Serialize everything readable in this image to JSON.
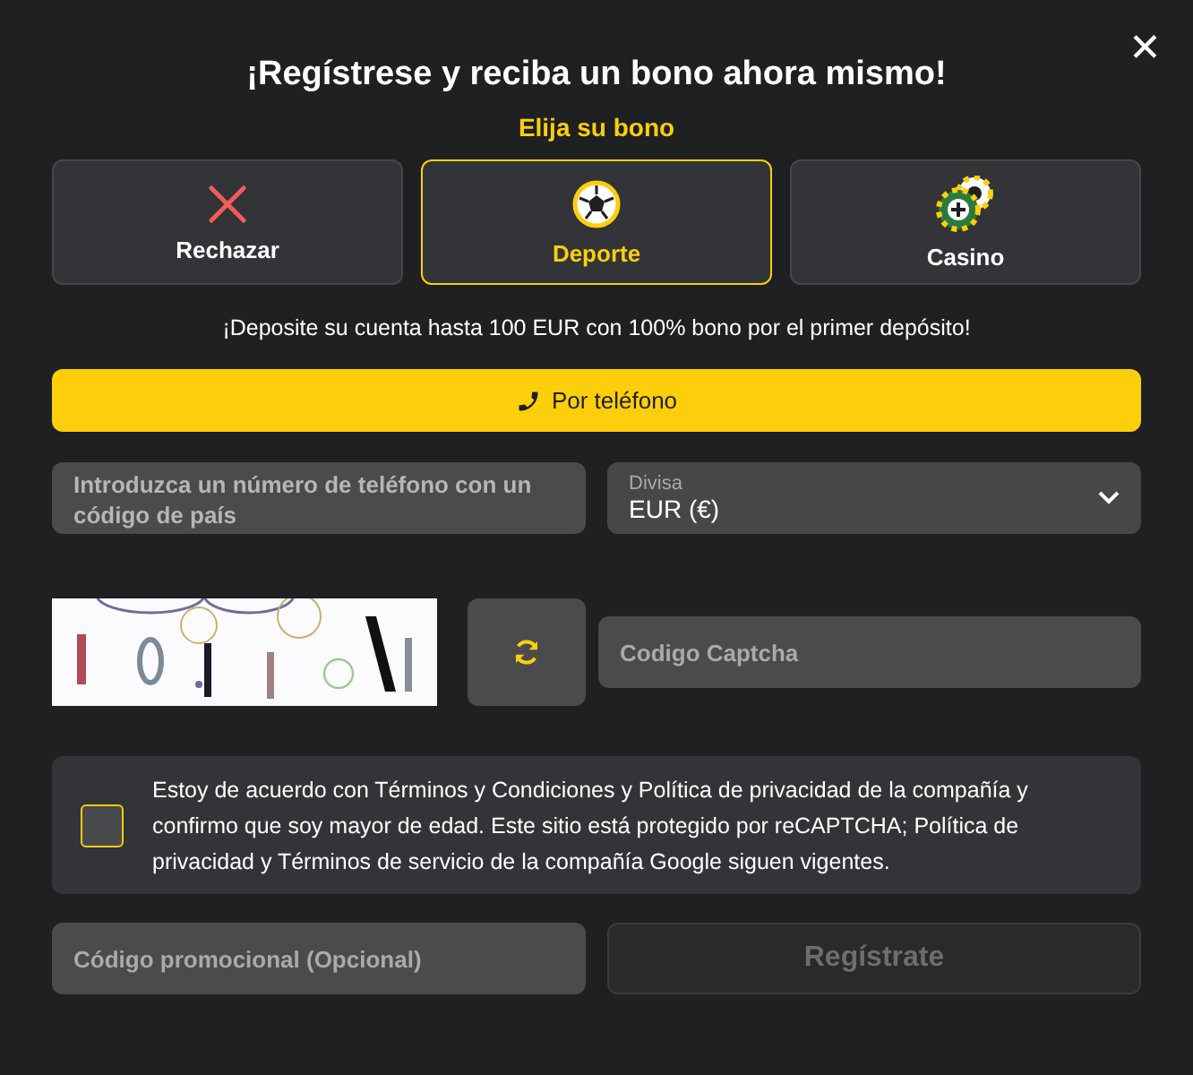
{
  "close_label": "✕",
  "title": "¡Regístrese y reciba un bono ahora mismo!",
  "subtitle": "Elija su bono",
  "bonuses": [
    {
      "label": "Rechazar",
      "kind": "reject",
      "selected": false
    },
    {
      "label": "Deporte",
      "kind": "sport",
      "selected": true
    },
    {
      "label": "Casino",
      "kind": "casino",
      "selected": false
    }
  ],
  "promo_text": "¡Deposite su cuenta hasta 100 EUR con 100% bono por el primer depósito!",
  "method_button": {
    "label": "Por teléfono",
    "selected": true
  },
  "phone_field": {
    "placeholder": "Introduzca un número de teléfono con un código de país"
  },
  "currency_select": {
    "label": "Divisa",
    "value": "EUR (€)"
  },
  "captcha_field": {
    "placeholder": "Codigo Captcha"
  },
  "agreement": {
    "checked": false,
    "text": "Estoy de acuerdo con Términos y Condiciones y Política de privacidad de la compañía y confirmo que soy mayor de edad. Este sitio está protegido por reCAPTCHA; Política de privacidad y Términos de servicio de la compañía Google siguen vigentes."
  },
  "promo_field": {
    "placeholder": "Código promocional (Opcional)"
  },
  "register_button": {
    "label": "Regístrate",
    "disabled": true
  }
}
